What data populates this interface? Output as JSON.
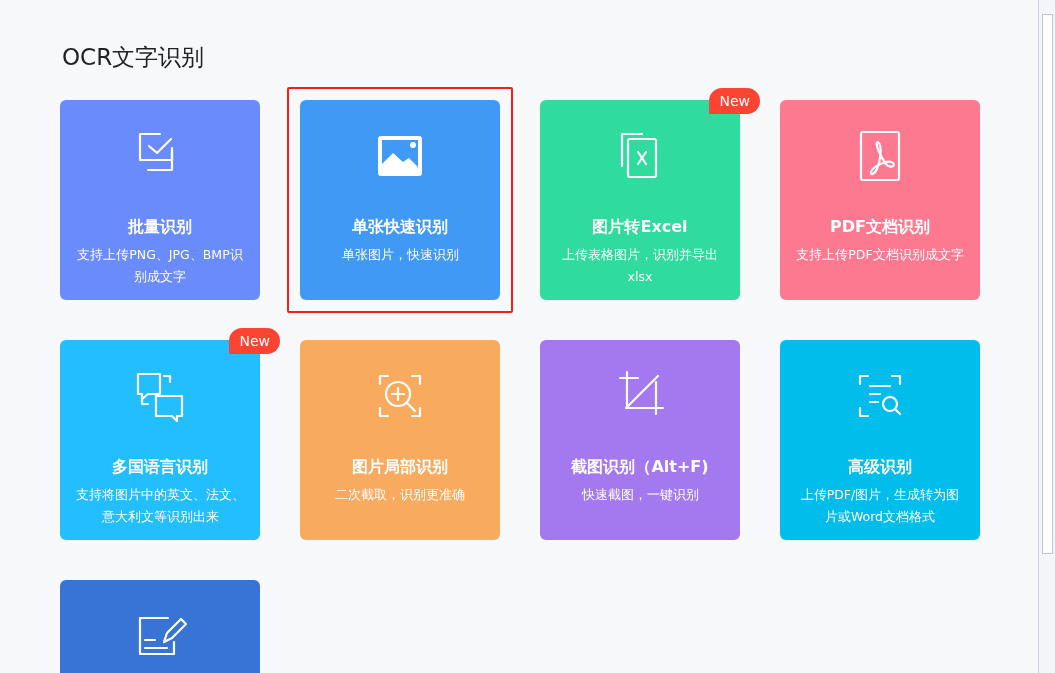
{
  "title": "OCR文字识别",
  "cards": [
    {
      "title": "批量识别",
      "description": "支持上传PNG、JPG、BMP识别成文字",
      "color": "#6a8bfb",
      "selected": false
    },
    {
      "title": "单张快速识别",
      "description": "单张图片，快速识别",
      "color": "#409af5",
      "selected": true
    },
    {
      "title": "图片转Excel",
      "description": "上传表格图片，识别并导出xlsx",
      "color": "#2fdb9f",
      "selected": false,
      "badge": "New"
    },
    {
      "title": "PDF文档识别",
      "description": "支持上传PDF文档识别成文字",
      "color": "#fd798f",
      "selected": false
    },
    {
      "title": "多国语言识别",
      "description": "支持将图片中的英文、法文、意大利文等识别出来",
      "color": "#22befd",
      "selected": false,
      "badge": "New"
    },
    {
      "title": "图片局部识别",
      "description": "二次截取，识别更准确",
      "color": "#f8ab5e",
      "selected": false
    },
    {
      "title": "截图识别（Alt+F)",
      "description": "快速截图，一键识别",
      "color": "#a478ef",
      "selected": false
    },
    {
      "title": "高级识别",
      "description": "上传PDF/图片，生成转为图片或Word文档格式",
      "color": "#00bdec",
      "selected": false
    },
    {
      "color": "#3774d6",
      "selected": false
    }
  ]
}
